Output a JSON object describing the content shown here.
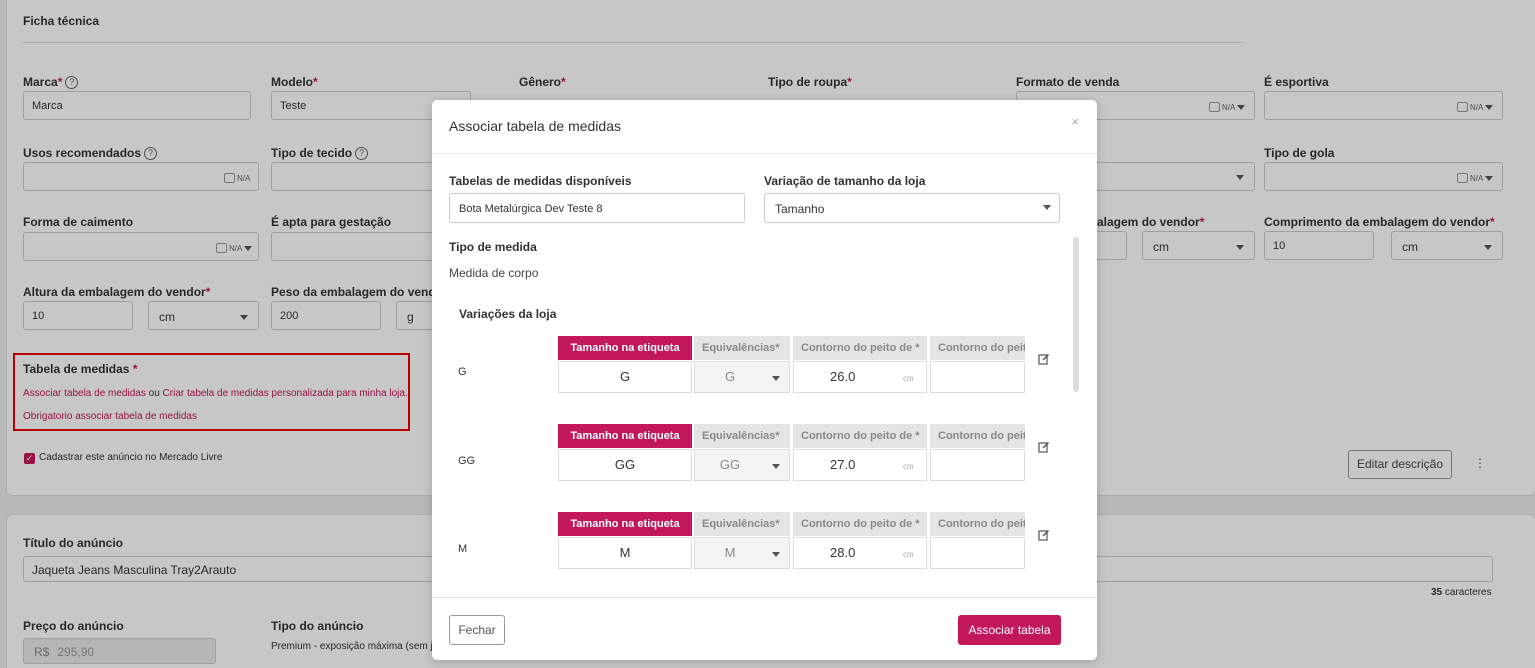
{
  "page": {
    "ficha_title": "Ficha técnica",
    "fields": {
      "marca": {
        "label": "Marca",
        "value": "Marca"
      },
      "modelo": {
        "label": "Modelo",
        "value": "Teste"
      },
      "genero": {
        "label": "Gênero"
      },
      "tipo_roupa": {
        "label": "Tipo de roupa"
      },
      "formato_venda": {
        "label": "Formato de venda"
      },
      "esportiva": {
        "label": "É esportiva"
      },
      "usos": {
        "label": "Usos recomendados"
      },
      "tipo_tecido": {
        "label": "Tipo de tecido"
      },
      "tipo_gola": {
        "label": "Tipo de gola"
      },
      "forma_caimento": {
        "label": "Forma de caimento"
      },
      "apta_gestacao": {
        "label": "É apta para gestação"
      },
      "largura_emb": {
        "label": "alagem do vendor"
      },
      "comprimento_emb": {
        "label": "Comprimento da embalagem do vendor",
        "value": "10",
        "unit": "cm"
      },
      "altura_emb": {
        "label": "Altura da embalagem do vendor",
        "value": "10",
        "unit": "cm"
      },
      "peso_emb": {
        "label": "Peso da embalagem do vendor",
        "value": "200",
        "unit": "g"
      },
      "largura_unit": "cm"
    },
    "na_label": "N/A",
    "asterisk": "*",
    "help_glyph": "?",
    "tabela": {
      "title": "Tabela de medidas",
      "link_associar": "Associar tabela de medidas",
      "ou": "ou",
      "link_criar": "Criar tabela de medidas personalizada para minha loja.",
      "error": "Obrigatorio associar tabela de medidas"
    },
    "mercado_livre_label": "Cadastrar este anúncio no Mercado Livre",
    "editar_descricao": "Editar descrição",
    "more_glyph": "⋮",
    "titulo_anuncio": {
      "label": "Título do anúncio",
      "value": "Jaqueta Jeans Masculina Tray2Arauto",
      "count": "35",
      "count_suffix": "caracteres"
    },
    "preco": {
      "label": "Preço do anúncio",
      "currency": "R$",
      "value": "295,90"
    },
    "tipo_anuncio": {
      "label": "Tipo do anúncio",
      "value": "Premium - exposição máxima (sem j"
    }
  },
  "modal": {
    "title": "Associar tabela de medidas",
    "close_glyph": "×",
    "tabelas_label": "Tabelas de medidas disponíveis",
    "tabelas_value": "Bota Metalúrgica Dev Teste 8",
    "variacao_label": "Variação de tamanho da loja",
    "variacao_value": "Tamanho",
    "tipo_medida_label": "Tipo de medida",
    "tipo_medida_value": "Medida de corpo",
    "variacoes_label": "Variações da loja",
    "headers": {
      "etiqueta": "Tamanho na etiqueta",
      "equivalencias": "Equivalências",
      "contorno1": "Contorno do peito de",
      "contorno2": "Contorno do peito"
    },
    "unit": "cm",
    "rows": [
      {
        "name": "G",
        "etiqueta": "G",
        "equivalencia": "G",
        "contorno": "26.0"
      },
      {
        "name": "GG",
        "etiqueta": "GG",
        "equivalencia": "GG",
        "contorno": "27.0"
      },
      {
        "name": "M",
        "etiqueta": "M",
        "equivalencia": "M",
        "contorno": "28.0"
      }
    ],
    "fechar": "Fechar",
    "associar": "Associar tabela"
  }
}
